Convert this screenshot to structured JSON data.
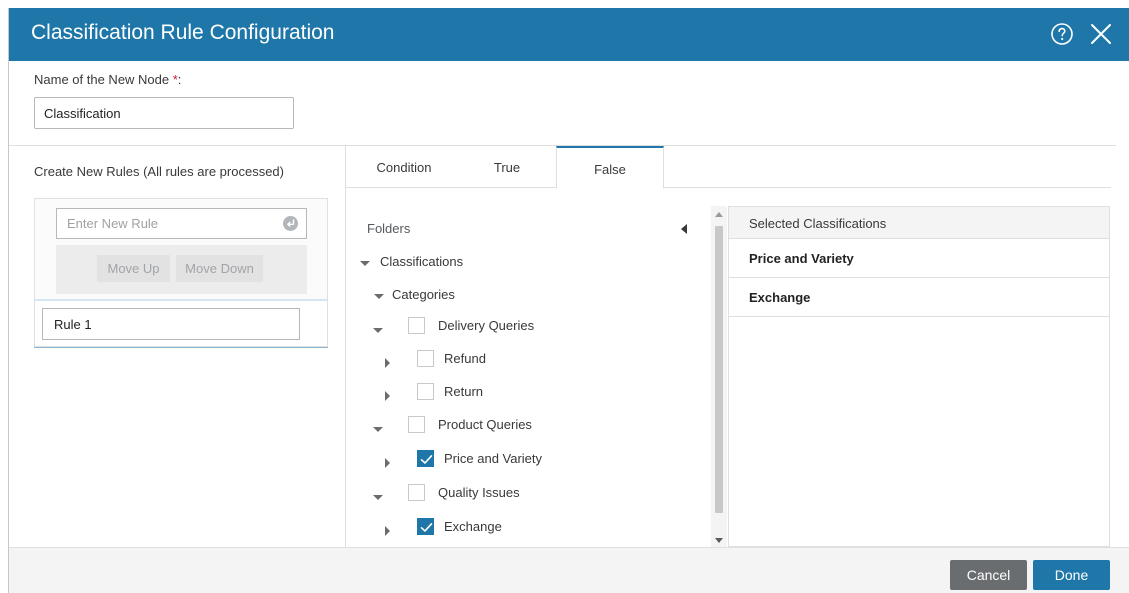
{
  "dialog": {
    "title": "Classification Rule Configuration",
    "help_icon": "help-circle-icon",
    "close_icon": "close-icon"
  },
  "node_name": {
    "label": "Name of the New Node ",
    "required_marker": "*",
    "label_suffix": ":",
    "value": "Classification"
  },
  "rules": {
    "title": "Create New Rules (All rules are processed)",
    "input_placeholder": "Enter New Rule",
    "move_up_label": "Move Up",
    "move_down_label": "Move Down",
    "items": [
      {
        "label": "Rule 1"
      }
    ]
  },
  "tabs": [
    {
      "label": "Condition",
      "active": false
    },
    {
      "label": "True",
      "active": false
    },
    {
      "label": "False",
      "active": true
    }
  ],
  "folders": {
    "header": "Folders",
    "tree": [
      {
        "label": "Classifications",
        "expanded": true
      },
      {
        "label": "Categories",
        "expanded": true
      },
      {
        "label": "Delivery Queries",
        "expanded": true,
        "checked": false
      },
      {
        "label": "Refund",
        "expanded": false,
        "checked": false
      },
      {
        "label": "Return",
        "expanded": false,
        "checked": false
      },
      {
        "label": "Product Queries",
        "expanded": true,
        "checked": false
      },
      {
        "label": "Price and Variety",
        "expanded": false,
        "checked": true
      },
      {
        "label": "Quality Issues",
        "expanded": true,
        "checked": false
      },
      {
        "label": "Exchange",
        "expanded": false,
        "checked": true
      }
    ]
  },
  "selected": {
    "header": "Selected Classifications",
    "items": [
      {
        "label": "Price and Variety"
      },
      {
        "label": "Exchange"
      }
    ]
  },
  "footer": {
    "cancel_label": "Cancel",
    "done_label": "Done"
  },
  "colors": {
    "brand_blue": "#1e77a8",
    "required_red": "#cf2030",
    "cancel_gray": "#6a6d70"
  }
}
